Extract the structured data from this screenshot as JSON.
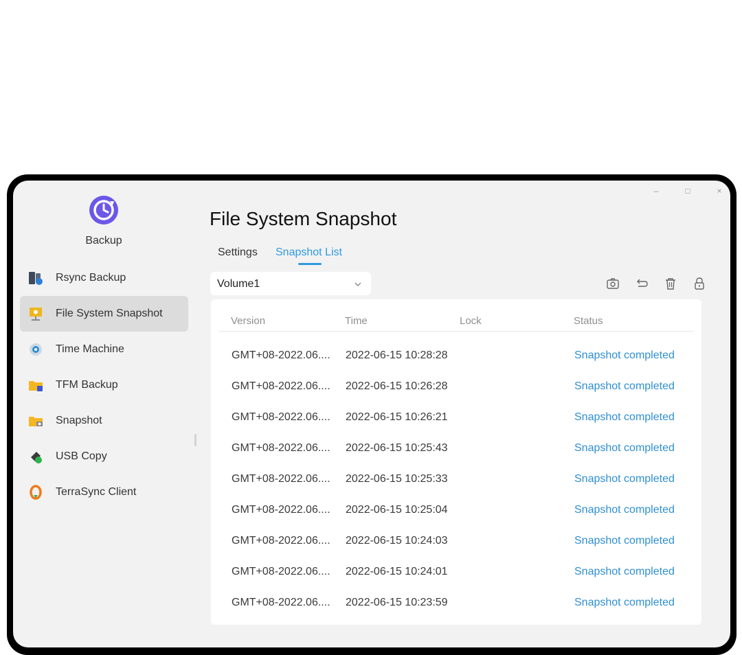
{
  "window": {
    "controls": {
      "minimize": "–",
      "maximize": "□",
      "close": "×"
    }
  },
  "app": {
    "name": "Backup",
    "icon": "backup-clock-icon"
  },
  "sidebar": {
    "items": [
      {
        "label": "Rsync Backup",
        "icon": "server-sync-icon",
        "active": false
      },
      {
        "label": "File System Snapshot",
        "icon": "snapshot-board-icon",
        "active": true
      },
      {
        "label": "Time Machine",
        "icon": "time-machine-icon",
        "active": false
      },
      {
        "label": "TFM Backup",
        "icon": "folder-backup-icon",
        "active": false
      },
      {
        "label": "Snapshot",
        "icon": "folder-camera-icon",
        "active": false
      },
      {
        "label": "USB Copy",
        "icon": "usb-drive-icon",
        "active": false
      },
      {
        "label": "TerraSync Client",
        "icon": "terrasync-icon",
        "active": false
      }
    ]
  },
  "main": {
    "title": "File System Snapshot",
    "tabs": [
      {
        "label": "Settings",
        "active": false
      },
      {
        "label": "Snapshot List",
        "active": true
      }
    ],
    "volume_select": {
      "value": "Volume1"
    },
    "toolbar": [
      "camera-icon",
      "restore-icon",
      "delete-icon",
      "lock-icon"
    ]
  },
  "table": {
    "columns": [
      "Version",
      "Time",
      "Lock",
      "Status"
    ],
    "rows": [
      {
        "version": "GMT+08-2022.06....",
        "time": "2022-06-15 10:28:28",
        "lock": "",
        "status": "Snapshot completed"
      },
      {
        "version": "GMT+08-2022.06....",
        "time": "2022-06-15 10:26:28",
        "lock": "",
        "status": "Snapshot completed"
      },
      {
        "version": "GMT+08-2022.06....",
        "time": "2022-06-15 10:26:21",
        "lock": "",
        "status": "Snapshot completed"
      },
      {
        "version": "GMT+08-2022.06....",
        "time": "2022-06-15 10:25:43",
        "lock": "",
        "status": "Snapshot completed"
      },
      {
        "version": "GMT+08-2022.06....",
        "time": "2022-06-15 10:25:33",
        "lock": "",
        "status": "Snapshot completed"
      },
      {
        "version": "GMT+08-2022.06....",
        "time": "2022-06-15 10:25:04",
        "lock": "",
        "status": "Snapshot completed"
      },
      {
        "version": "GMT+08-2022.06....",
        "time": "2022-06-15 10:24:03",
        "lock": "",
        "status": "Snapshot completed"
      },
      {
        "version": "GMT+08-2022.06....",
        "time": "2022-06-15 10:24:01",
        "lock": "",
        "status": "Snapshot completed"
      },
      {
        "version": "GMT+08-2022.06....",
        "time": "2022-06-15 10:23:59",
        "lock": "",
        "status": "Snapshot completed"
      }
    ]
  },
  "colors": {
    "accent": "#2f9ae0",
    "status": "#2f8fd0",
    "sidebar_active": "#dcdcdc",
    "window_bg": "#f2f2f2"
  }
}
